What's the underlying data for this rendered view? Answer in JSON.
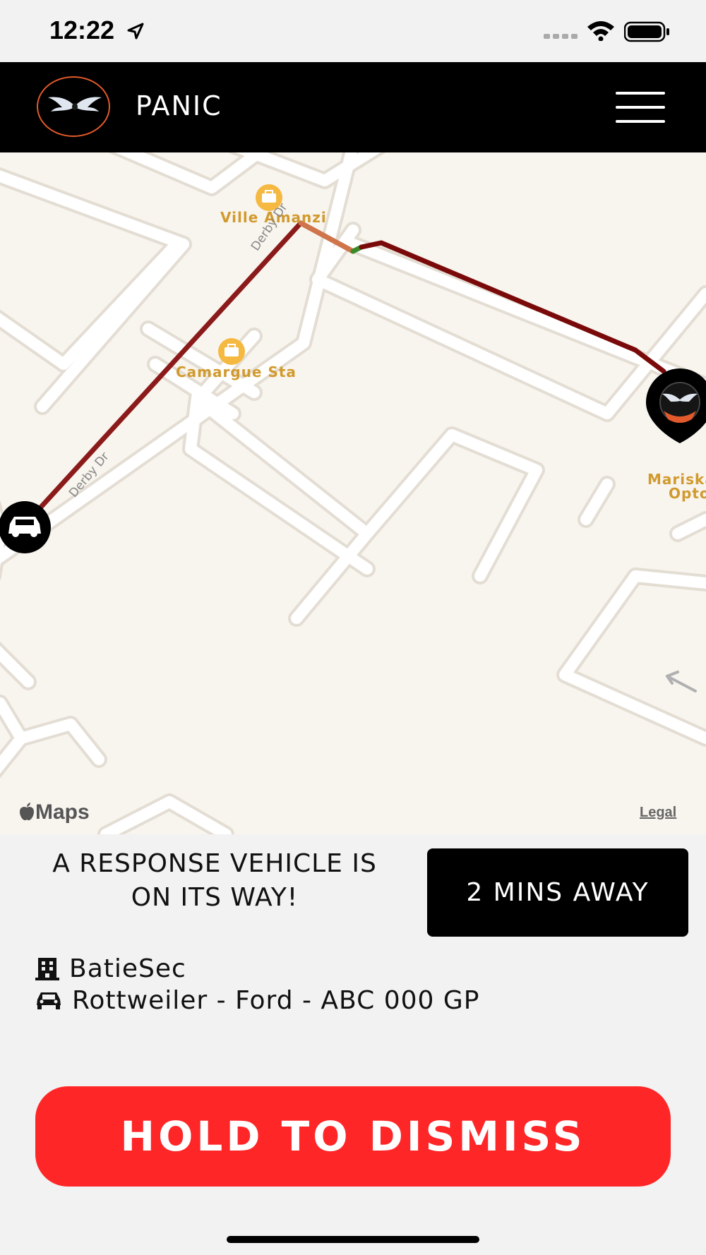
{
  "status_bar": {
    "time": "12:22"
  },
  "nav": {
    "title": "PANIC"
  },
  "map": {
    "poi": [
      {
        "label": "Ville Amanzi"
      },
      {
        "label": "Camargue Sta"
      },
      {
        "label": "Mariska"
      },
      {
        "label": "Opto"
      }
    ],
    "streets": [
      "Derby Dr",
      "Derby Dr"
    ],
    "attribution": "Maps",
    "legal": "Legal"
  },
  "response": {
    "message_line1": "A RESPONSE VEHICLE IS",
    "message_line2": "ON ITS WAY!",
    "eta": "2 MINS AWAY",
    "company": "BatieSec",
    "vehicle": "Rottweiler - Ford - ABC 000 GP"
  },
  "actions": {
    "dismiss_label": "HOLD TO DISMISS"
  },
  "colors": {
    "accent": "#ff2628",
    "route": "#7a0a0a",
    "nav_bg": "#000000",
    "logo_ring": "#e25a2b"
  }
}
